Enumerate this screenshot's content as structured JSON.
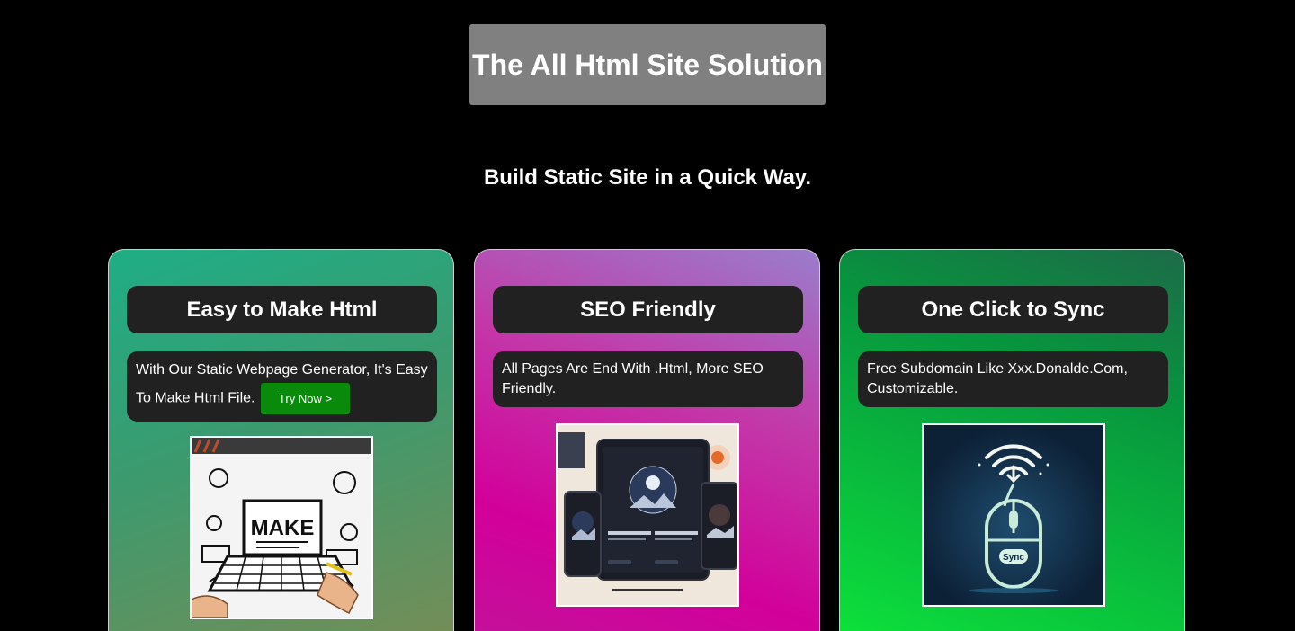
{
  "header": {
    "title": "The All Html Site Solution",
    "subtitle": "Build Static Site in a Quick Way."
  },
  "cards": [
    {
      "heading": "Easy to Make Html",
      "description": "With Our Static Webpage Generator, It's Easy To Make Html File.",
      "button_label": "Try Now >",
      "image_label": "MAKE",
      "gradient": [
        "#1fae86",
        "#3c9a6e",
        "#7a8c55"
      ]
    },
    {
      "heading": "SEO Friendly",
      "description": "All Pages Are End With .Html, More SEO Friendly.",
      "gradient": [
        "#9a7dcc",
        "#d2009a",
        "#c0149a"
      ]
    },
    {
      "heading": "One Click to Sync",
      "description": "Free Subdomain Like Xxx.Donalde.Com, Customizable.",
      "image_label": "Sync",
      "gradient": [
        "#1d6a48",
        "#07953e",
        "#0fe83a"
      ]
    }
  ],
  "colors": {
    "background": "#000000",
    "title_box": "#808080",
    "card_panel": "#212121",
    "button": "#0a8a0a"
  }
}
